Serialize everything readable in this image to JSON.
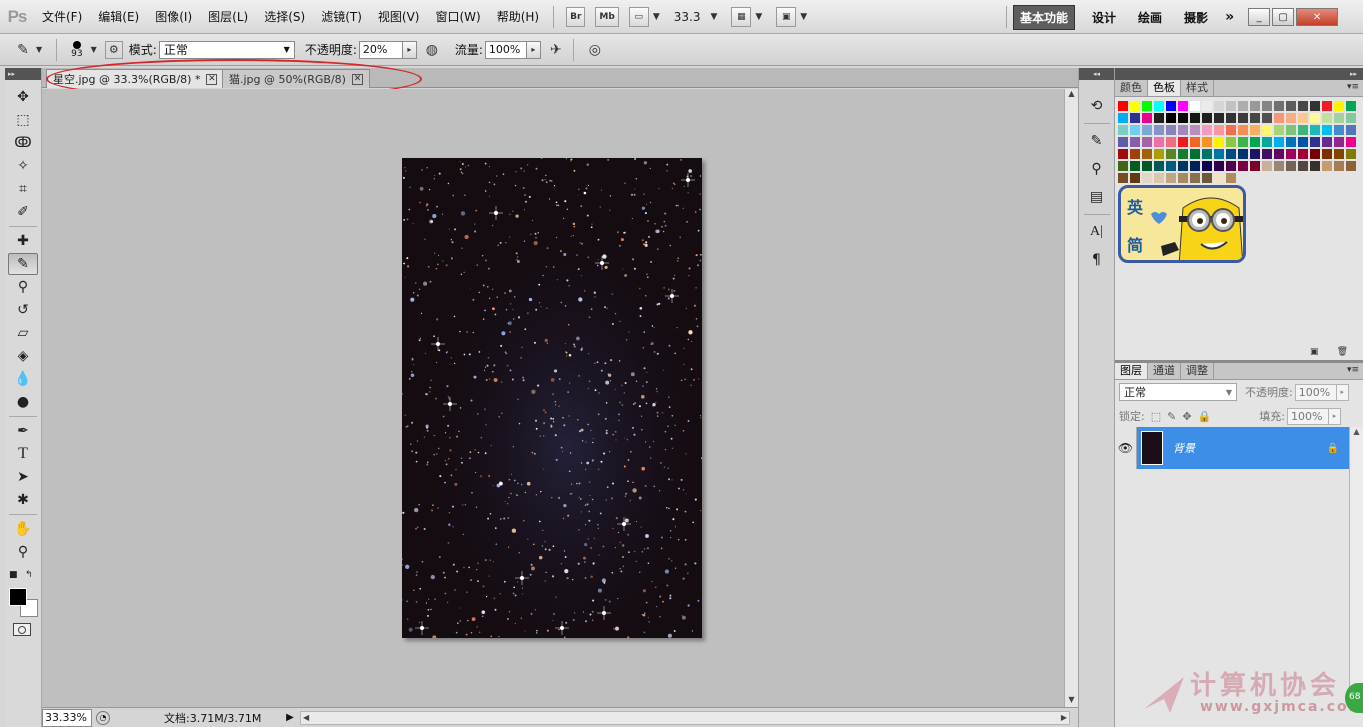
{
  "app": {
    "logo": "Ps"
  },
  "menu": [
    "文件(F)",
    "编辑(E)",
    "图像(I)",
    "图层(L)",
    "选择(S)",
    "滤镜(T)",
    "视图(V)",
    "窗口(W)",
    "帮助(H)"
  ],
  "menubar": {
    "br": "Br",
    "mb": "Mb",
    "zoom": "33.3",
    "dropdown": "▼"
  },
  "workspaces": [
    "基本功能",
    "设计",
    "绘画",
    "摄影"
  ],
  "window_controls": {
    "more": "»",
    "minimize": "_",
    "restore": "▢",
    "close": "✕"
  },
  "options": {
    "brush_size": "93",
    "mode_label": "模式:",
    "mode_value": "正常",
    "opacity_label": "不透明度:",
    "opacity_value": "20%",
    "flow_label": "流量:",
    "flow_value": "100%",
    "spin_arrow": "▸"
  },
  "tabs": [
    {
      "label": "星空.jpg @ 33.3%(RGB/8) *",
      "close": "✕"
    },
    {
      "label": "猫.jpg @ 50%(RGB/8)",
      "close": "✕"
    }
  ],
  "status": {
    "zoom": "33.33%",
    "doc": "文档:3.71M/3.71M",
    "arrow": "▶"
  },
  "panels": {
    "color_tabs": [
      "颜色",
      "色板",
      "样式"
    ],
    "layer_tabs": [
      "图层",
      "通道",
      "调整"
    ],
    "blend_mode": "正常",
    "opacity_label": "不透明度:",
    "opacity_value": "100%",
    "lock_label": "锁定:",
    "fill_label": "填充:",
    "fill_value": "100%",
    "layer_name": "背景",
    "minion_text_1": "英",
    "minion_text_2": "简"
  },
  "swatch_colors": [
    "#ff0000",
    "#ffff00",
    "#00ff00",
    "#00ffff",
    "#0000ff",
    "#ff00ff",
    "#ffffff",
    "#ebebeb",
    "#d6d6d6",
    "#c2c2c2",
    "#adadad",
    "#999999",
    "#858585",
    "#707070",
    "#5c5c5c",
    "#474747",
    "#333333",
    "#ee1c24",
    "#fff200",
    "#00a651",
    "#00aeef",
    "#2e3192",
    "#ec008c",
    "#1f1f1f",
    "#000000",
    "#0a0a0a",
    "#141414",
    "#1e1e1e",
    "#282828",
    "#323232",
    "#3c3c3c",
    "#464646",
    "#505050",
    "#f7977a",
    "#f9ad81",
    "#fdc68a",
    "#fff79a",
    "#c4df9b",
    "#a3d39c",
    "#82ca9d",
    "#7bcdc8",
    "#6ecff6",
    "#7ea7d8",
    "#8493ca",
    "#8882be",
    "#a187be",
    "#bc8dbf",
    "#f49ac2",
    "#f6989d",
    "#f26c4f",
    "#f68e56",
    "#fbaf5d",
    "#fff568",
    "#acd373",
    "#7cc576",
    "#3bb878",
    "#1abbb4",
    "#00bff3",
    "#438ccb",
    "#5574b9",
    "#605ca8",
    "#855fa8",
    "#a763a8",
    "#f06ea9",
    "#f26d7d",
    "#ed1c24",
    "#f26522",
    "#f7941d",
    "#fff200",
    "#8dc73f",
    "#39b54a",
    "#00a651",
    "#00a99d",
    "#00aeef",
    "#0072bc",
    "#0054a6",
    "#2e3192",
    "#662d91",
    "#92278f",
    "#ec008c",
    "#9e0b0f",
    "#a0410d",
    "#a36209",
    "#aba000",
    "#598527",
    "#197b30",
    "#007236",
    "#00746b",
    "#0076a3",
    "#004b80",
    "#003471",
    "#1b1464",
    "#440e62",
    "#630460",
    "#9e005d",
    "#9e0039",
    "#790000",
    "#7b2e00",
    "#7d4900",
    "#827b00",
    "#406618",
    "#005e20",
    "#005826",
    "#005952",
    "#005b7f",
    "#003663",
    "#002157",
    "#0d004c",
    "#32004b",
    "#4b0049",
    "#7b0046",
    "#7a0026",
    "#c7b299",
    "#998675",
    "#736357",
    "#534741",
    "#37302d",
    "#c69c6d",
    "#a67c52",
    "#8c6239",
    "#754c24",
    "#603913",
    "#e0d7c7",
    "#d8c8ac",
    "#bfa783",
    "#a68b61",
    "#8a704a",
    "#6e5838",
    "#f0e2c4",
    "#b08c5a"
  ]
}
